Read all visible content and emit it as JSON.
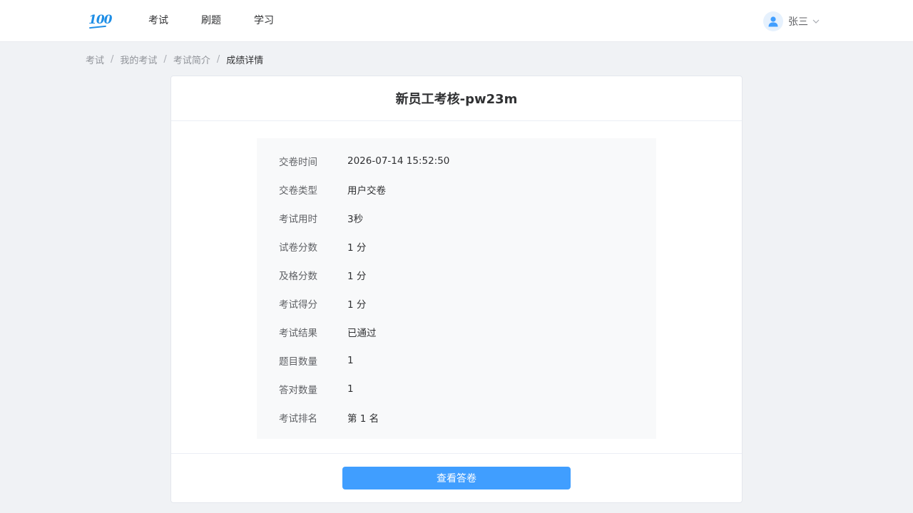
{
  "header": {
    "logo_text": "100",
    "nav": [
      "考试",
      "刷题",
      "学习"
    ],
    "user": {
      "name": "张三"
    }
  },
  "breadcrumb": [
    "考试",
    "我的考试",
    "考试简介",
    "成绩详情"
  ],
  "breadcrumb_separator": "/",
  "exam": {
    "title": "新员工考核-pw23m",
    "details": [
      {
        "label": "交卷时间",
        "value": "2026-07-14 15:52:50"
      },
      {
        "label": "交卷类型",
        "value": "用户交卷"
      },
      {
        "label": "考试用时",
        "value": "3秒"
      },
      {
        "label": "试卷分数",
        "value": "1 分"
      },
      {
        "label": "及格分数",
        "value": "1 分"
      },
      {
        "label": "考试得分",
        "value": "1 分"
      },
      {
        "label": "考试结果",
        "value": "已通过"
      },
      {
        "label": "题目数量",
        "value": "1"
      },
      {
        "label": "答对数量",
        "value": "1"
      },
      {
        "label": "考试排名",
        "value": "第 1 名"
      }
    ],
    "view_button_label": "查看答卷"
  },
  "colors": {
    "primary": "#409eff",
    "logo": "#1e8ee6",
    "background": "#f0f2f5"
  },
  "icons": {
    "avatar": "user-icon",
    "dropdown": "chevron-down-icon"
  }
}
